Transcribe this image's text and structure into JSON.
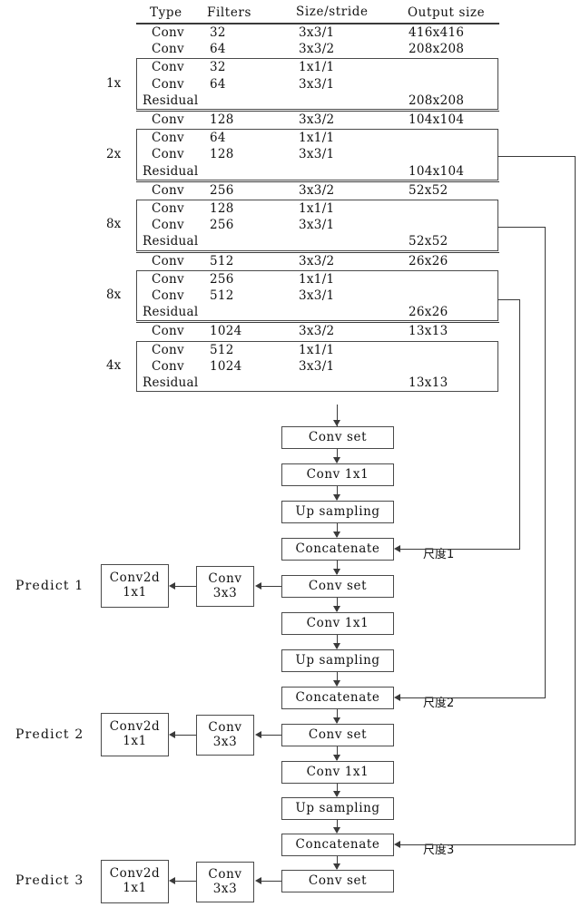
{
  "table": {
    "headers": [
      "Type",
      "Filters",
      "Size/stride",
      "Output size"
    ],
    "groups": [
      {
        "multiplier": "",
        "boxed": false,
        "rows": [
          {
            "type": "Conv",
            "filters": "32",
            "size": "3x3/1",
            "output": "416x416"
          },
          {
            "type": "Conv",
            "filters": "64",
            "size": "3x3/2",
            "output": "208x208"
          }
        ]
      },
      {
        "multiplier": "1x",
        "boxed": true,
        "rows": [
          {
            "type": "Conv",
            "filters": "32",
            "size": "1x1/1",
            "output": ""
          },
          {
            "type": "Conv",
            "filters": "64",
            "size": "3x3/1",
            "output": ""
          },
          {
            "type": "Residual",
            "filters": "",
            "size": "",
            "output": "208x208"
          }
        ]
      },
      {
        "multiplier": "",
        "boxed": false,
        "rows": [
          {
            "type": "Conv",
            "filters": "128",
            "size": "3x3/2",
            "output": "104x104"
          }
        ]
      },
      {
        "multiplier": "2x",
        "boxed": true,
        "rows": [
          {
            "type": "Conv",
            "filters": "64",
            "size": "1x1/1",
            "output": ""
          },
          {
            "type": "Conv",
            "filters": "128",
            "size": "3x3/1",
            "output": ""
          },
          {
            "type": "Residual",
            "filters": "",
            "size": "",
            "output": "104x104"
          }
        ]
      },
      {
        "multiplier": "",
        "boxed": false,
        "rows": [
          {
            "type": "Conv",
            "filters": "256",
            "size": "3x3/2",
            "output": "52x52"
          }
        ]
      },
      {
        "multiplier": "8x",
        "boxed": true,
        "rows": [
          {
            "type": "Conv",
            "filters": "128",
            "size": "1x1/1",
            "output": ""
          },
          {
            "type": "Conv",
            "filters": "256",
            "size": "3x3/1",
            "output": ""
          },
          {
            "type": "Residual",
            "filters": "",
            "size": "",
            "output": "52x52"
          }
        ]
      },
      {
        "multiplier": "",
        "boxed": false,
        "rows": [
          {
            "type": "Conv",
            "filters": "512",
            "size": "3x3/2",
            "output": "26x26"
          }
        ]
      },
      {
        "multiplier": "8x",
        "boxed": true,
        "rows": [
          {
            "type": "Conv",
            "filters": "256",
            "size": "1x1/1",
            "output": ""
          },
          {
            "type": "Conv",
            "filters": "512",
            "size": "3x3/1",
            "output": ""
          },
          {
            "type": "Residual",
            "filters": "",
            "size": "",
            "output": "26x26"
          }
        ]
      },
      {
        "multiplier": "",
        "boxed": false,
        "rows": [
          {
            "type": "Conv",
            "filters": "1024",
            "size": "3x3/2",
            "output": "13x13"
          }
        ]
      },
      {
        "multiplier": "4x",
        "boxed": true,
        "rows": [
          {
            "type": "Conv",
            "filters": "512",
            "size": "1x1/1",
            "output": ""
          },
          {
            "type": "Conv",
            "filters": "1024",
            "size": "3x3/1",
            "output": ""
          },
          {
            "type": "Residual",
            "filters": "",
            "size": "",
            "output": "13x13"
          }
        ]
      }
    ]
  },
  "flow": {
    "stage1": {
      "conv_set": "Conv set",
      "conv_1x1": "Conv 1x1",
      "upsampling": "Up sampling",
      "concatenate": "Concatenate",
      "scale_label": "尺度1",
      "conv_set_2": "Conv set",
      "conv_3x3": "Conv",
      "conv_3x3_sub": "3x3",
      "conv2d": "Conv2d",
      "conv2d_sub": "1x1",
      "predict": "Predict 1"
    },
    "stage2": {
      "conv_1x1": "Conv 1x1",
      "upsampling": "Up sampling",
      "concatenate": "Concatenate",
      "scale_label": "尺度2",
      "conv_set_2": "Conv set",
      "conv_3x3": "Conv",
      "conv_3x3_sub": "3x3",
      "conv2d": "Conv2d",
      "conv2d_sub": "1x1",
      "predict": "Predict 2"
    },
    "stage3": {
      "conv_1x1": "Conv 1x1",
      "upsampling": "Up sampling",
      "concatenate": "Concatenate",
      "scale_label": "尺度3",
      "conv_set_2": "Conv set",
      "conv_3x3": "Conv",
      "conv_3x3_sub": "3x3",
      "conv2d": "Conv2d",
      "conv2d_sub": "1x1",
      "predict": "Predict 3"
    }
  },
  "colors": {
    "line": "#3a3a3a",
    "border": "#4a4a4a",
    "text": "#111111",
    "background": "#ffffff"
  }
}
